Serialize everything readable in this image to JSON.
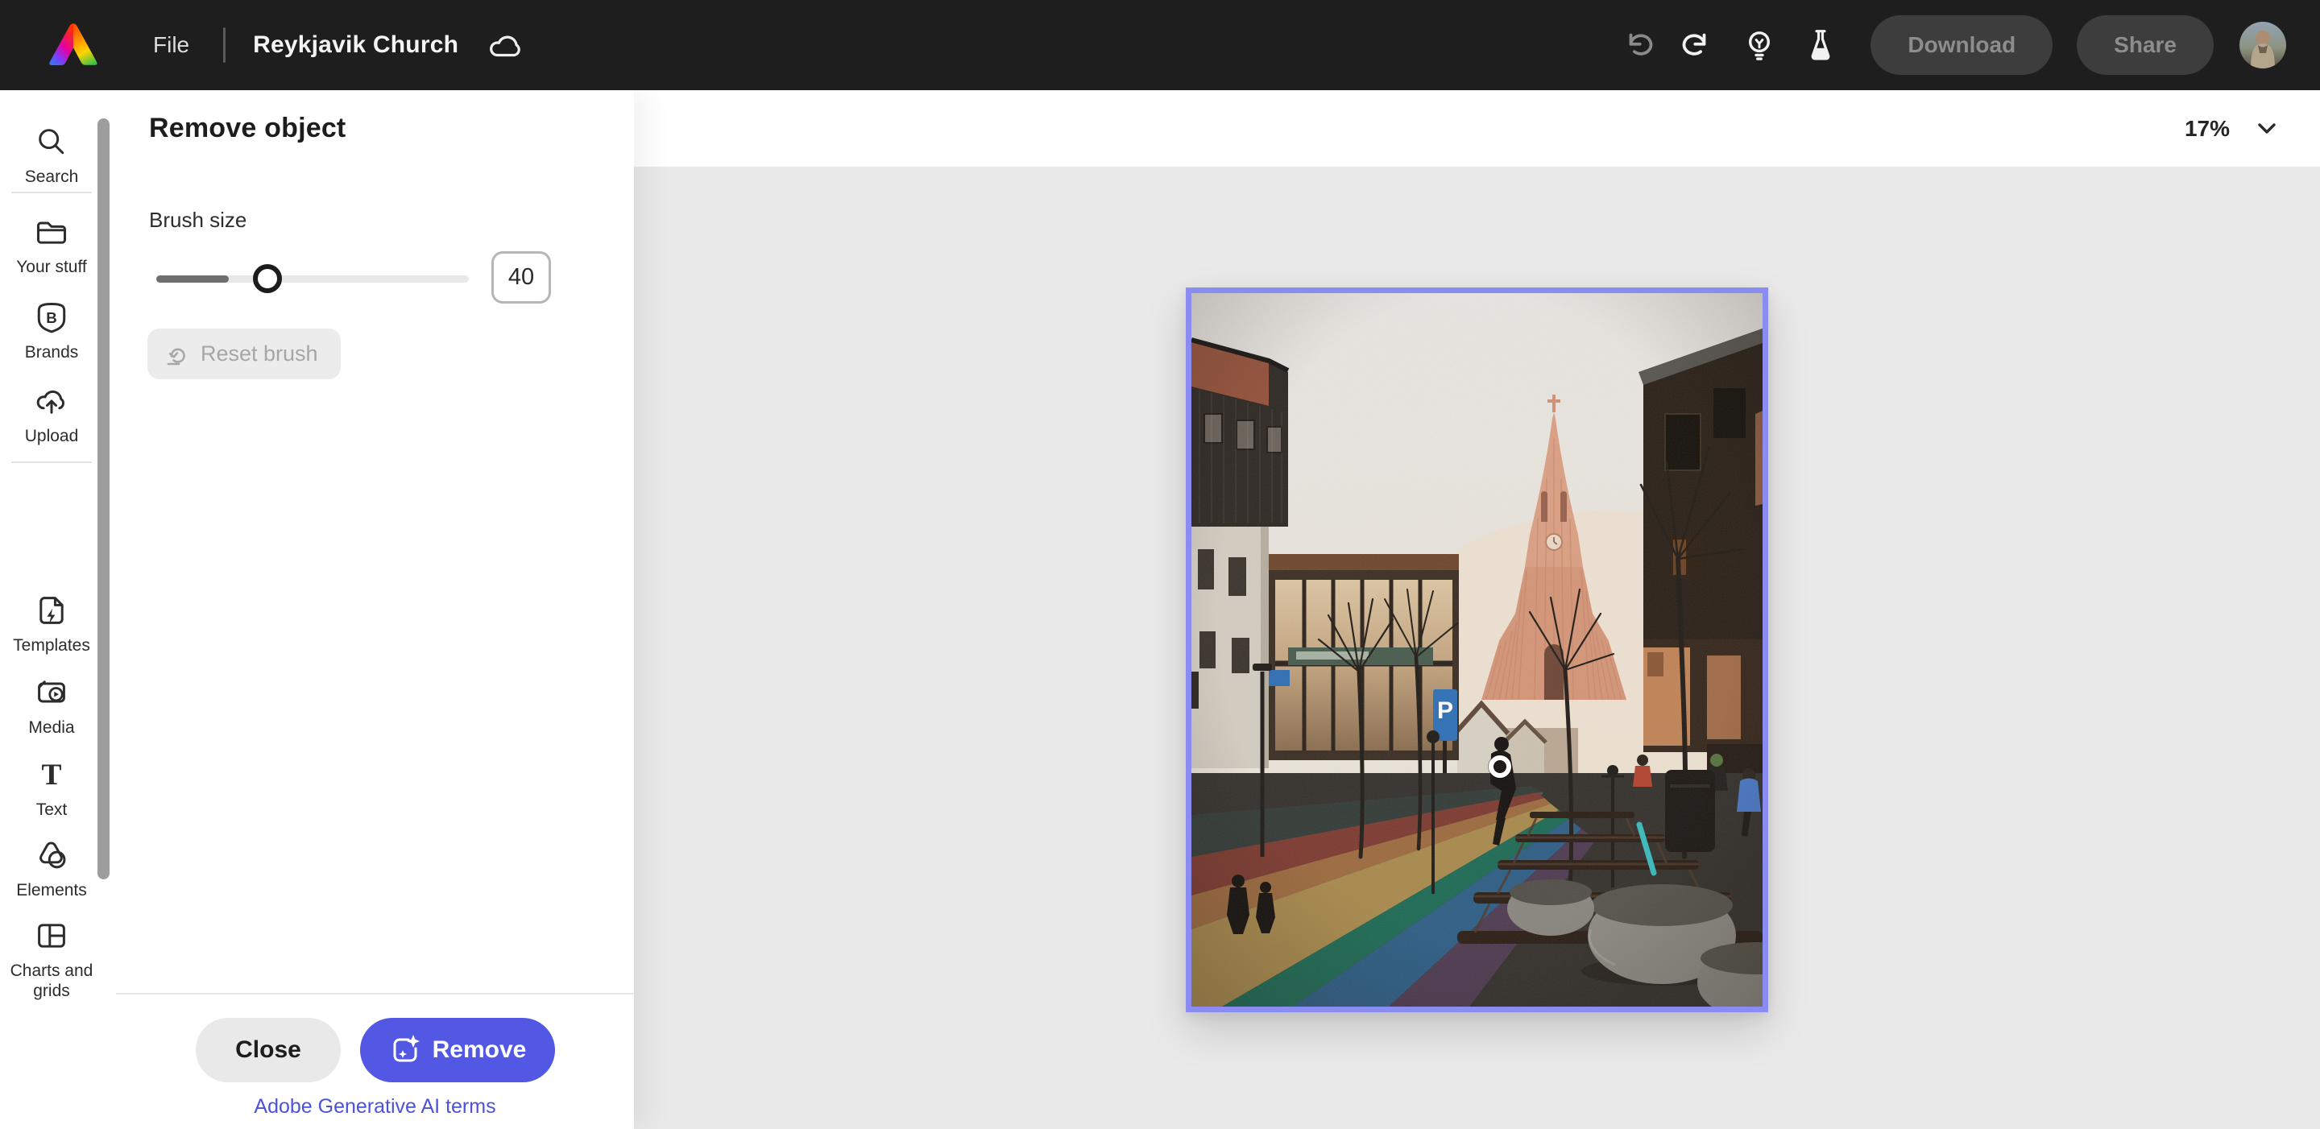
{
  "topbar": {
    "file_label": "File",
    "doc_title": "Reykjavik Church",
    "download_label": "Download",
    "share_label": "Share"
  },
  "sidebar": {
    "items": [
      {
        "label": "Search"
      },
      {
        "label": "Your stuff"
      },
      {
        "label": "Brands"
      },
      {
        "label": "Upload"
      },
      {
        "label": "Templates"
      },
      {
        "label": "Media"
      },
      {
        "label": "Text"
      },
      {
        "label": "Elements"
      },
      {
        "label": "Charts and grids"
      }
    ]
  },
  "panel": {
    "title": "Remove object",
    "brush": {
      "label": "Brush size",
      "value": "40"
    },
    "reset_label": "Reset brush",
    "close_label": "Close",
    "remove_label": "Remove",
    "terms_link": "Adobe Generative AI terms"
  },
  "canvas": {
    "zoom_level": "17%"
  },
  "colors": {
    "accent": "#5258e4",
    "selection_border": "#8b8cf1",
    "link": "#4d53d8",
    "topbar_bg": "#1e1e1e",
    "canvas_bg": "#e9e9e9"
  }
}
